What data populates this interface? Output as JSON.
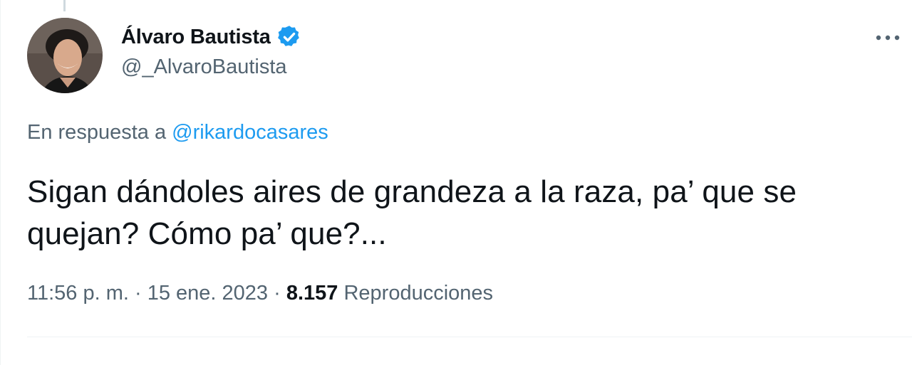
{
  "tweet": {
    "author": {
      "display_name": "Álvaro Bautista",
      "handle": "@_AlvaroBautista",
      "verified": true
    },
    "reply_to": {
      "prefix": "En respuesta a ",
      "mention": "@rikardocasares"
    },
    "text_line_1": "Sigan dándoles aires de grandeza a la raza, pa’ que se",
    "text_line_2": "quejan? Cómo pa’ que?...",
    "time": "11:56 p. m.",
    "separator": " · ",
    "date": "15 ene. 2023",
    "views_count": "8.157",
    "views_label": " Reproducciones"
  },
  "icons": {
    "verified": "verified-badge-icon",
    "more": "more-options-icon"
  },
  "colors": {
    "text_primary": "#0f1419",
    "text_secondary": "#536471",
    "accent": "#1d9bf0",
    "divider": "#eff3f4"
  }
}
